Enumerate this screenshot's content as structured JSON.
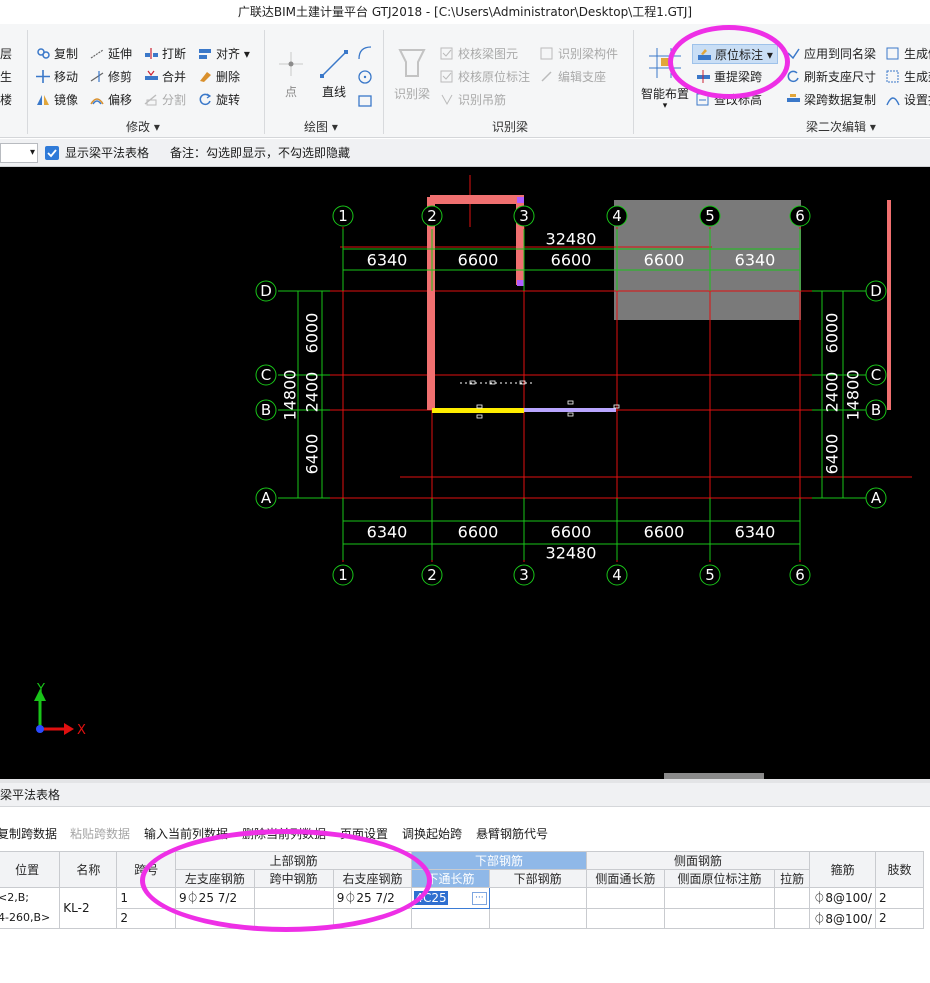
{
  "window": {
    "title": "广联达BIM土建计量平台 GTJ2018 - [C:\\Users\\Administrator\\Desktop\\工程1.GTJ]"
  },
  "ribbon": {
    "edge_labels": [
      "层",
      "生",
      "楼"
    ],
    "modify": {
      "label": "修改",
      "items": [
        "复制",
        "延伸",
        "打断",
        "对齐",
        "移动",
        "修剪",
        "合并",
        "删除",
        "镜像",
        "偏移",
        "分割",
        "旋转"
      ]
    },
    "draw": {
      "label": "绘图",
      "point": "点",
      "line": "直线"
    },
    "identify": {
      "label": "识别梁",
      "big": "识别梁",
      "items": [
        "校核梁图元",
        "识别梁构件",
        "校核原位标注",
        "编辑支座",
        "识别吊筋"
      ]
    },
    "secondary": {
      "label": "梁二次编辑",
      "smart": "智能布置",
      "items": [
        "原位标注",
        "应用到同名梁",
        "生成侧",
        "重提梁跨",
        "刷新支座尺寸",
        "生成架",
        "查改标高",
        "梁跨数据复制",
        "设置拱"
      ]
    }
  },
  "option_bar": {
    "checkbox_label": "显示梁平法表格",
    "checked": true,
    "note": "备注：勾选即显示，不勾选即隐藏"
  },
  "drawing": {
    "axes_x": [
      "1",
      "2",
      "3",
      "4",
      "5",
      "6"
    ],
    "axes_y": [
      "D",
      "C",
      "B",
      "A"
    ],
    "top_dims": [
      "6340",
      "6600",
      "6600",
      "6600",
      "6340"
    ],
    "bottom_dims": [
      "6340",
      "6600",
      "6600",
      "6600",
      "6340"
    ],
    "total_x": "32480",
    "left_dims": [
      "6000",
      "2400",
      "6400"
    ],
    "total_y": "14800",
    "ucs": {
      "y": "Y",
      "x": "X"
    }
  },
  "panel": {
    "title": "梁平法表格",
    "tools": [
      {
        "label": "复制跨数据",
        "enabled": true
      },
      {
        "label": "粘贴跨数据",
        "enabled": false
      },
      {
        "label": "输入当前列数据",
        "enabled": true
      },
      {
        "label": "删除当前列数据",
        "enabled": true
      },
      {
        "label": "页面设置",
        "enabled": true
      },
      {
        "label": "调换起始跨",
        "enabled": true
      },
      {
        "label": "悬臂钢筋代号",
        "enabled": true
      }
    ],
    "headers": {
      "position": "位置",
      "name": "名称",
      "span_no": "跨号",
      "top_group": "上部钢筋",
      "bottom_group": "下部钢筋",
      "side_group": "侧面钢筋",
      "stirrup": "箍筋",
      "legs": "肢数",
      "top_left": "左支座钢筋",
      "top_mid": "跨中钢筋",
      "top_right": "右支座钢筋",
      "bottom_through": "下通长筋",
      "bottom_bar": "下部钢筋",
      "side_through": "侧面通长筋",
      "side_inplace": "侧面原位标注筋",
      "tie": "拉筋"
    },
    "rows": [
      {
        "position": "<2,B;",
        "position2": "4-260,B>",
        "name": "KL-2",
        "span": "1",
        "top_left": "9⏀25 7/2",
        "top_mid": "",
        "top_right": "9⏀25 7/2",
        "bottom_through": "4C25",
        "stirrup": "⏀8@100/",
        "legs": "2"
      },
      {
        "span": "2",
        "stirrup": "⏀8@100/",
        "legs": "2"
      }
    ]
  }
}
